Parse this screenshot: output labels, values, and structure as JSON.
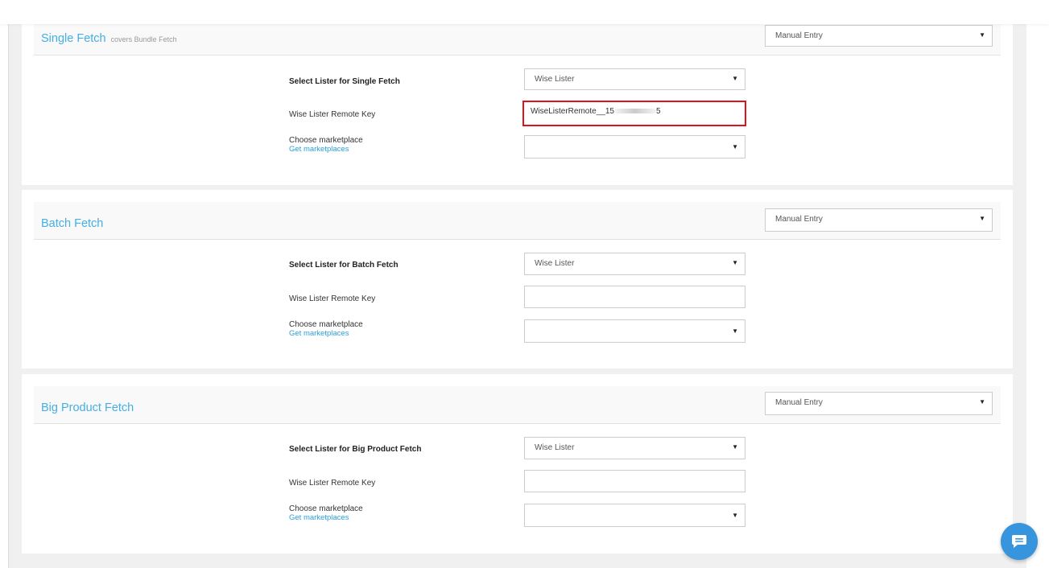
{
  "sections": [
    {
      "title": "Single Fetch",
      "subtitle": "covers Bundle Fetch",
      "mode_value": "Manual Entry",
      "lister_label": "Select Lister for Single Fetch",
      "lister_value": "Wise Lister",
      "remote_key_label": "Wise Lister Remote Key",
      "remote_key_value_prefix": "WiseListerRemote__15",
      "remote_key_value_suffix": "5",
      "marketplace_label": "Choose marketplace",
      "marketplace_link": "Get marketplaces",
      "marketplace_value": ""
    },
    {
      "title": "Batch Fetch",
      "mode_value": "Manual Entry",
      "lister_label": "Select Lister for Batch Fetch",
      "lister_value": "Wise Lister",
      "remote_key_label": "Wise Lister Remote Key",
      "remote_key_value": "",
      "marketplace_label": "Choose marketplace",
      "marketplace_link": "Get marketplaces",
      "marketplace_value": ""
    },
    {
      "title": "Big Product Fetch",
      "mode_value": "Manual Entry",
      "lister_label": "Select Lister for Big Product Fetch",
      "lister_value": "Wise Lister",
      "remote_key_label": "Wise Lister Remote Key",
      "remote_key_value": "",
      "marketplace_label": "Choose marketplace",
      "marketplace_link": "Get marketplaces",
      "marketplace_value": ""
    }
  ],
  "highlight_color": "#e0131d",
  "accent_color": "#45aee3",
  "chat_widget": {
    "icon": "chat-icon",
    "color": "#3795dd"
  }
}
